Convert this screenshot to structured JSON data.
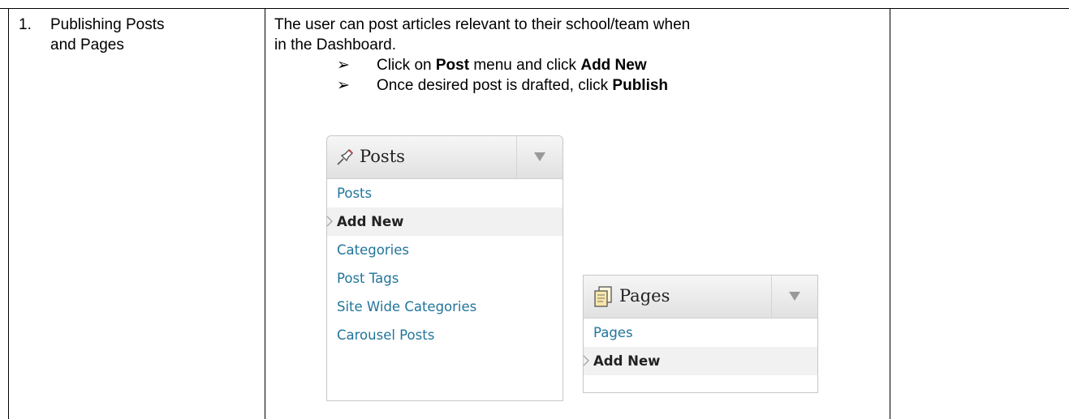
{
  "row": {
    "number": "1.",
    "title_line1": "Publishing Posts",
    "title_line2": "and Pages",
    "description_line1": "The user can post articles relevant to their school/team when",
    "description_line2": "in the Dashboard.",
    "bullets": [
      {
        "prefix": "Click on ",
        "bold1": "Post",
        "middle": " menu and click ",
        "bold2": "Add New"
      },
      {
        "prefix": "Once desired post is drafted, click ",
        "bold1": "Publish"
      }
    ],
    "bullet_glyph": "➢"
  },
  "posts_menu": {
    "title": "Posts",
    "icon": "pushpin-icon",
    "items": [
      {
        "label": "Posts"
      },
      {
        "label": "Add New",
        "current": true
      },
      {
        "label": "Categories"
      },
      {
        "label": "Post Tags"
      },
      {
        "label": "Site Wide Categories"
      },
      {
        "label": "Carousel Posts"
      }
    ]
  },
  "pages_menu": {
    "title": "Pages",
    "icon": "pages-icon",
    "items": [
      {
        "label": "Pages"
      },
      {
        "label": "Add New",
        "current": true
      }
    ]
  },
  "colors": {
    "link": "#21759b",
    "header_top": "#f6f6f6",
    "header_bottom": "#e1e1e1",
    "current_bg": "#f1f1f1"
  }
}
